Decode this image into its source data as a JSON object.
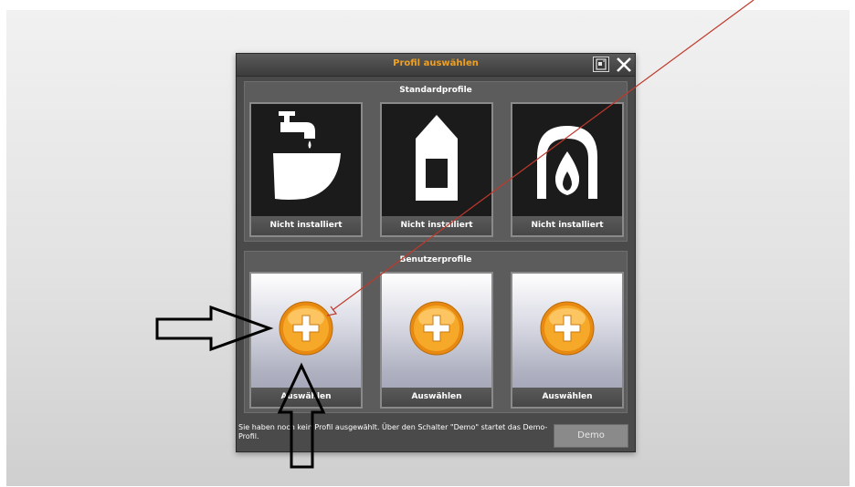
{
  "dialog": {
    "title": "Profil auswählen",
    "help_icon": "help-book-icon",
    "close_icon": "close-x-icon",
    "title_color": "#f0a020"
  },
  "standard_profiles": {
    "heading": "Standardprofile",
    "items": [
      {
        "icon": "faucet-basin-icon",
        "label": "Nicht installiert"
      },
      {
        "icon": "house-icon",
        "label": "Nicht installiert"
      },
      {
        "icon": "fireplace-flame-icon",
        "label": "Nicht installiert"
      }
    ]
  },
  "user_profiles": {
    "heading": "Benutzerprofile",
    "items": [
      {
        "icon": "add-plus-icon",
        "label": "Auswählen"
      },
      {
        "icon": "add-plus-icon",
        "label": "Auswählen"
      },
      {
        "icon": "add-plus-icon",
        "label": "Auswählen"
      }
    ]
  },
  "footer": {
    "message": "Sie haben noch kein Profil ausgewählt. Über den Schalter \"Demo\" startet das Demo-Profil.",
    "demo_label": "Demo"
  },
  "annotations": {
    "arrow_color": "#000000",
    "line_color": "#c0392b"
  }
}
